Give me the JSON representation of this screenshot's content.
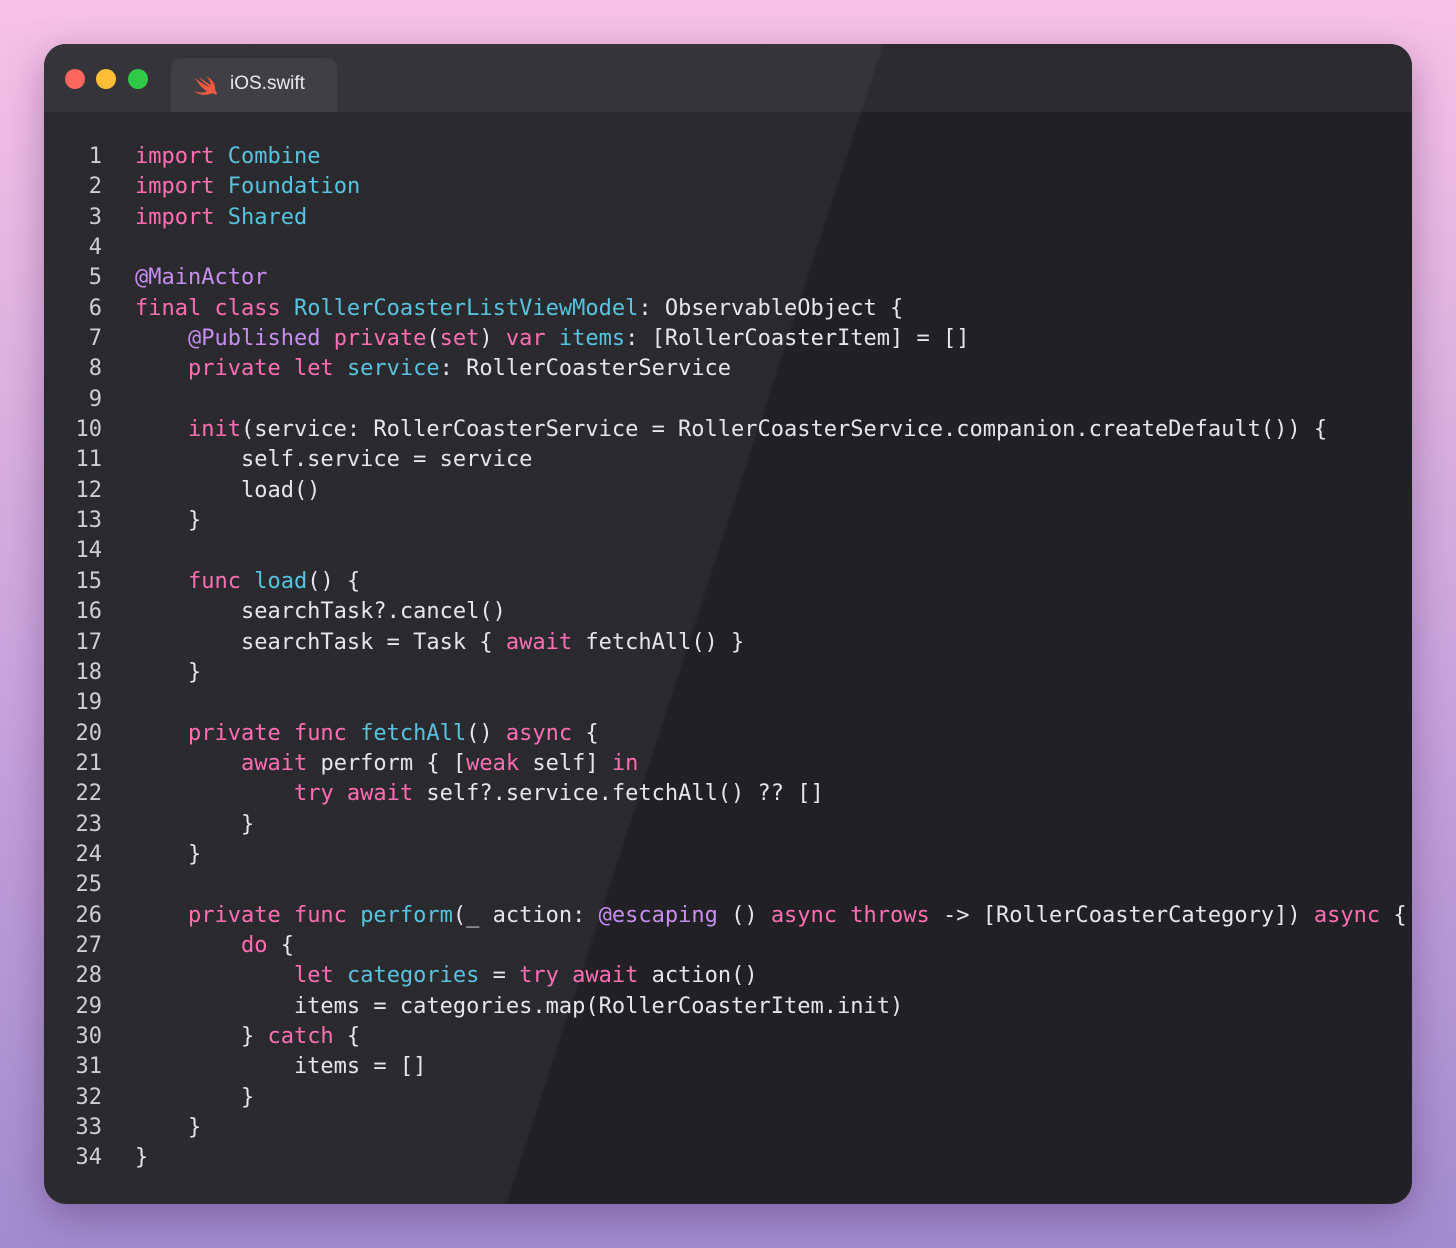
{
  "window": {
    "tab_label": "iOS.swift",
    "tab_icon": "swift-logo-icon"
  },
  "colors": {
    "keyword": "#ff6eb4",
    "type": "#57c4df",
    "attribute": "#c68ef0",
    "plain": "#e6e6e8",
    "background": "#212025"
  },
  "code": [
    {
      "n": "1",
      "tokens": [
        [
          "kw",
          "import"
        ],
        [
          "p",
          " "
        ],
        [
          "ty",
          "Combine"
        ]
      ]
    },
    {
      "n": "2",
      "tokens": [
        [
          "kw",
          "import"
        ],
        [
          "p",
          " "
        ],
        [
          "ty",
          "Foundation"
        ]
      ]
    },
    {
      "n": "3",
      "tokens": [
        [
          "kw",
          "import"
        ],
        [
          "p",
          " "
        ],
        [
          "ty",
          "Shared"
        ]
      ]
    },
    {
      "n": "4",
      "tokens": []
    },
    {
      "n": "5",
      "tokens": [
        [
          "at",
          "@MainActor"
        ]
      ]
    },
    {
      "n": "6",
      "tokens": [
        [
          "kw",
          "final class"
        ],
        [
          "p",
          " "
        ],
        [
          "ty",
          "RollerCoasterListViewModel"
        ],
        [
          "p",
          ": ObservableObject {"
        ]
      ]
    },
    {
      "n": "7",
      "tokens": [
        [
          "p",
          "    "
        ],
        [
          "at",
          "@Published"
        ],
        [
          "p",
          " "
        ],
        [
          "kw",
          "private"
        ],
        [
          "p",
          "("
        ],
        [
          "kw",
          "set"
        ],
        [
          "p",
          ") "
        ],
        [
          "kw",
          "var"
        ],
        [
          "p",
          " "
        ],
        [
          "ty",
          "items"
        ],
        [
          "p",
          ": [RollerCoasterItem] = []"
        ]
      ]
    },
    {
      "n": "8",
      "tokens": [
        [
          "p",
          "    "
        ],
        [
          "kw",
          "private let"
        ],
        [
          "p",
          " "
        ],
        [
          "ty",
          "service"
        ],
        [
          "p",
          ": RollerCoasterService"
        ]
      ]
    },
    {
      "n": "9",
      "tokens": []
    },
    {
      "n": "10",
      "tokens": [
        [
          "p",
          "    "
        ],
        [
          "kw",
          "init"
        ],
        [
          "p",
          "(service: RollerCoasterService = RollerCoasterService.companion.createDefault()) {"
        ]
      ]
    },
    {
      "n": "11",
      "tokens": [
        [
          "p",
          "        self.service = service"
        ]
      ]
    },
    {
      "n": "12",
      "tokens": [
        [
          "p",
          "        load()"
        ]
      ]
    },
    {
      "n": "13",
      "tokens": [
        [
          "p",
          "    }"
        ]
      ]
    },
    {
      "n": "14",
      "tokens": []
    },
    {
      "n": "15",
      "tokens": [
        [
          "p",
          "    "
        ],
        [
          "kw",
          "func"
        ],
        [
          "p",
          " "
        ],
        [
          "ty",
          "load"
        ],
        [
          "p",
          "() {"
        ]
      ]
    },
    {
      "n": "16",
      "tokens": [
        [
          "p",
          "        searchTask?.cancel()"
        ]
      ]
    },
    {
      "n": "17",
      "tokens": [
        [
          "p",
          "        searchTask = Task { "
        ],
        [
          "kw",
          "await"
        ],
        [
          "p",
          " fetchAll() }"
        ]
      ]
    },
    {
      "n": "18",
      "tokens": [
        [
          "p",
          "    }"
        ]
      ]
    },
    {
      "n": "19",
      "tokens": []
    },
    {
      "n": "20",
      "tokens": [
        [
          "p",
          "    "
        ],
        [
          "kw",
          "private func"
        ],
        [
          "p",
          " "
        ],
        [
          "ty",
          "fetchAll"
        ],
        [
          "p",
          "() "
        ],
        [
          "kw",
          "async"
        ],
        [
          "p",
          " {"
        ]
      ]
    },
    {
      "n": "21",
      "tokens": [
        [
          "p",
          "        "
        ],
        [
          "kw",
          "await"
        ],
        [
          "p",
          " perform { ["
        ],
        [
          "kw",
          "weak"
        ],
        [
          "p",
          " self] "
        ],
        [
          "kw",
          "in"
        ]
      ]
    },
    {
      "n": "22",
      "tokens": [
        [
          "p",
          "            "
        ],
        [
          "kw",
          "try await"
        ],
        [
          "p",
          " self?.service.fetchAll() ?? []"
        ]
      ]
    },
    {
      "n": "23",
      "tokens": [
        [
          "p",
          "        }"
        ]
      ]
    },
    {
      "n": "24",
      "tokens": [
        [
          "p",
          "    }"
        ]
      ]
    },
    {
      "n": "25",
      "tokens": []
    },
    {
      "n": "26",
      "tokens": [
        [
          "p",
          "    "
        ],
        [
          "kw",
          "private func"
        ],
        [
          "p",
          " "
        ],
        [
          "ty",
          "perform"
        ],
        [
          "p",
          "(_ action: "
        ],
        [
          "at",
          "@escaping"
        ],
        [
          "p",
          " () "
        ],
        [
          "kw",
          "async throws"
        ],
        [
          "p",
          " -> [RollerCoasterCategory]) "
        ],
        [
          "kw",
          "async"
        ],
        [
          "p",
          " {"
        ]
      ]
    },
    {
      "n": "27",
      "tokens": [
        [
          "p",
          "        "
        ],
        [
          "kw",
          "do"
        ],
        [
          "p",
          " {"
        ]
      ]
    },
    {
      "n": "28",
      "tokens": [
        [
          "p",
          "            "
        ],
        [
          "kw",
          "let"
        ],
        [
          "p",
          " "
        ],
        [
          "ty",
          "categories"
        ],
        [
          "p",
          " = "
        ],
        [
          "kw",
          "try await"
        ],
        [
          "p",
          " action()"
        ]
      ]
    },
    {
      "n": "29",
      "tokens": [
        [
          "p",
          "            items = categories.map(RollerCoasterItem.init)"
        ]
      ]
    },
    {
      "n": "30",
      "tokens": [
        [
          "p",
          "        } "
        ],
        [
          "kw",
          "catch"
        ],
        [
          "p",
          " {"
        ]
      ]
    },
    {
      "n": "31",
      "tokens": [
        [
          "p",
          "            items = []"
        ]
      ]
    },
    {
      "n": "32",
      "tokens": [
        [
          "p",
          "        }"
        ]
      ]
    },
    {
      "n": "33",
      "tokens": [
        [
          "p",
          "    }"
        ]
      ]
    },
    {
      "n": "34",
      "tokens": [
        [
          "p",
          "}"
        ]
      ]
    }
  ]
}
